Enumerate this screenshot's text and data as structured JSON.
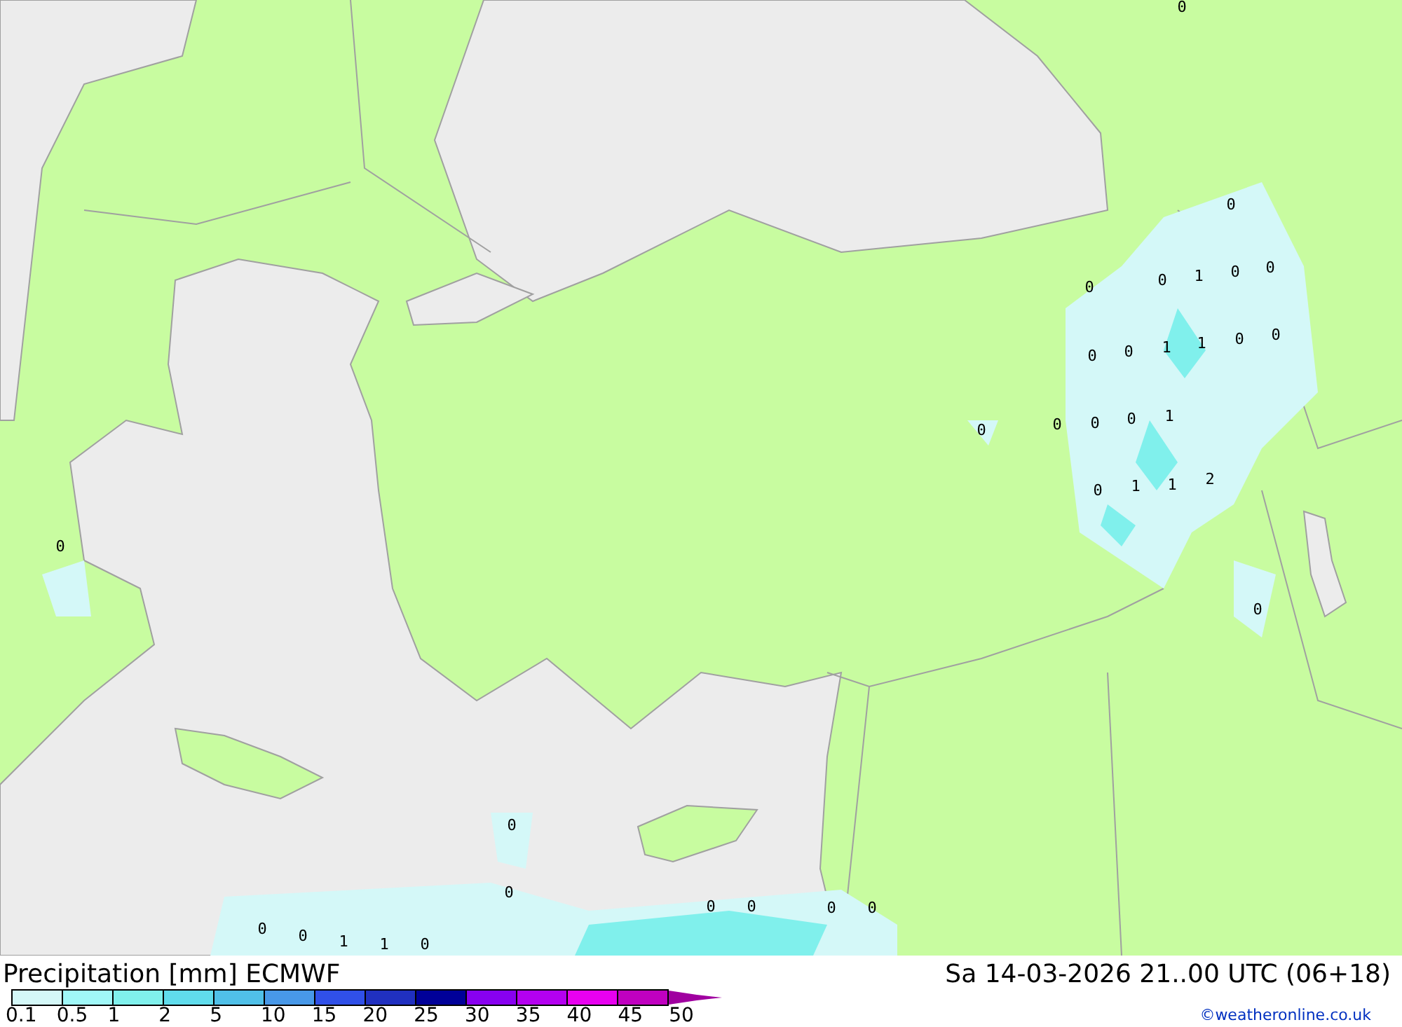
{
  "map": {
    "values": [
      {
        "text": "0"
      },
      {
        "text": "0"
      },
      {
        "text": "0"
      },
      {
        "text": "0"
      },
      {
        "text": "1"
      },
      {
        "text": "0"
      },
      {
        "text": "0"
      },
      {
        "text": "0"
      },
      {
        "text": "0"
      },
      {
        "text": "1"
      },
      {
        "text": "1"
      },
      {
        "text": "0"
      },
      {
        "text": "0"
      },
      {
        "text": "0"
      },
      {
        "text": "0"
      },
      {
        "text": "0"
      },
      {
        "text": "0"
      },
      {
        "text": "1"
      },
      {
        "text": "0"
      },
      {
        "text": "1"
      },
      {
        "text": "1"
      },
      {
        "text": "2"
      },
      {
        "text": "0"
      },
      {
        "text": "0"
      },
      {
        "text": "0"
      },
      {
        "text": "0"
      },
      {
        "text": "0"
      },
      {
        "text": "0"
      },
      {
        "text": "1"
      },
      {
        "text": "1"
      },
      {
        "text": "0"
      },
      {
        "text": "0"
      },
      {
        "text": "0"
      },
      {
        "text": "0"
      },
      {
        "text": "0"
      }
    ]
  },
  "legend": {
    "title": "Precipitation [mm] ECMWF",
    "valid_time": "Sa 14-03-2026 21..00 UTC (06+18)",
    "bins": [
      {
        "color": "#d4f8f8"
      },
      {
        "color": "#a0f8f8"
      },
      {
        "color": "#80f0ec"
      },
      {
        "color": "#60dcec"
      },
      {
        "color": "#50c0e8"
      },
      {
        "color": "#4898e8"
      },
      {
        "color": "#3050e8"
      },
      {
        "color": "#2030c0"
      },
      {
        "color": "#000098"
      },
      {
        "color": "#8800f0"
      },
      {
        "color": "#b400f0"
      },
      {
        "color": "#e800f0"
      },
      {
        "color": "#c000c0"
      },
      {
        "color": "#a000a0",
        "kind": "arrow"
      }
    ],
    "scale_labels": [
      "0.1",
      "0.5",
      "1",
      "2",
      "5",
      "10",
      "15",
      "20",
      "25",
      "30",
      "35",
      "40",
      "45",
      "50"
    ],
    "credit": "©weatheronline.co.uk"
  }
}
